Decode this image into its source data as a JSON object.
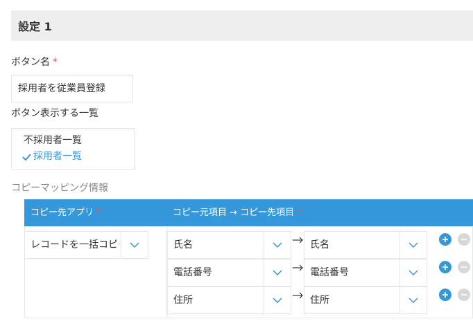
{
  "section": {
    "title": "設定 1"
  },
  "button_name": {
    "label": "ボタン名",
    "required_mark": "*",
    "value": "採用者を従業員登録"
  },
  "display_list": {
    "label": "ボタン表示する一覧",
    "items": [
      {
        "label": "不採用者一覧",
        "selected": false
      },
      {
        "label": "採用者一覧",
        "selected": true
      }
    ]
  },
  "mapping": {
    "label": "コピーマッピング情報",
    "header_app": "コピー先アプリ",
    "header_fields": "コピー元項目 → コピー先項目",
    "required_mark": "*",
    "app_select": "レコードを一括コピー",
    "rows": [
      {
        "source": "氏名",
        "target": "氏名"
      },
      {
        "source": "電話番号",
        "target": "電話番号"
      },
      {
        "source": "住所",
        "target": "住所"
      }
    ]
  },
  "colors": {
    "accent": "#3498db",
    "required": "#e74c3c",
    "header_bg": "#eeeeee"
  },
  "icons": [
    "check-icon",
    "chevron-down-icon",
    "arrow-right-icon",
    "plus-icon",
    "minus-icon"
  ]
}
